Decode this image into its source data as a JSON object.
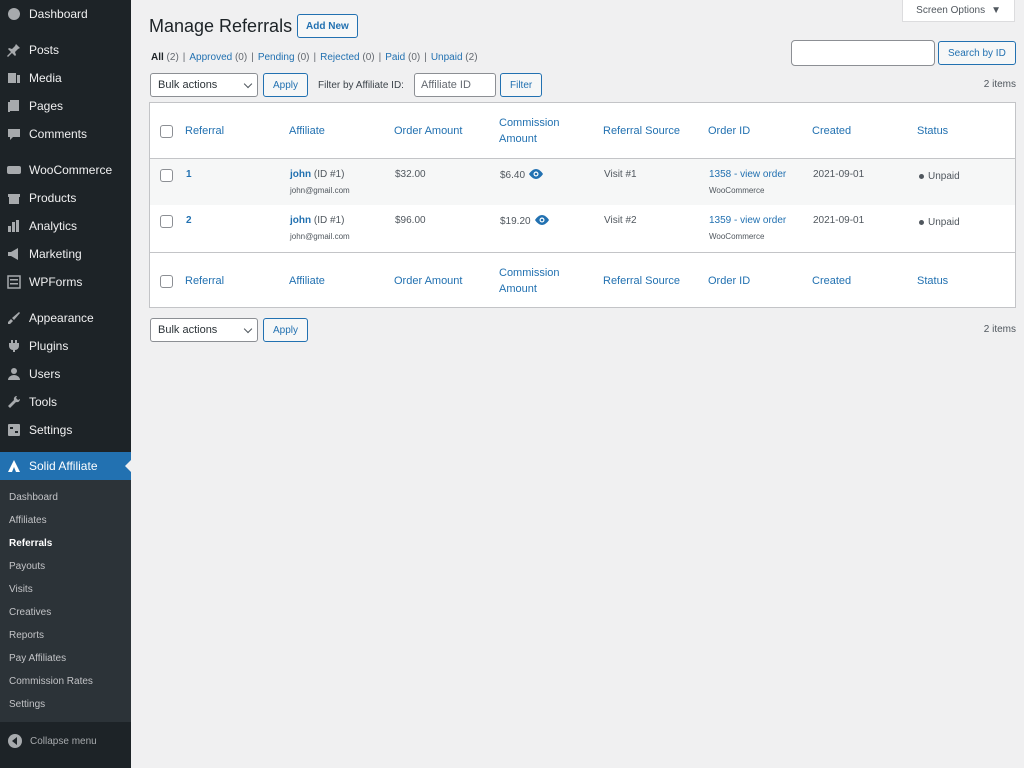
{
  "sidebar": {
    "groups": [
      [
        {
          "label": "Dashboard",
          "icon": "dashboard-icon"
        }
      ],
      [
        {
          "label": "Posts",
          "icon": "pin-icon"
        },
        {
          "label": "Media",
          "icon": "media-icon"
        },
        {
          "label": "Pages",
          "icon": "pages-icon"
        },
        {
          "label": "Comments",
          "icon": "comments-icon"
        }
      ],
      [
        {
          "label": "WooCommerce",
          "icon": "woocommerce-icon"
        },
        {
          "label": "Products",
          "icon": "products-icon"
        },
        {
          "label": "Analytics",
          "icon": "analytics-icon"
        },
        {
          "label": "Marketing",
          "icon": "megaphone-icon"
        },
        {
          "label": "WPForms",
          "icon": "wpforms-icon"
        }
      ],
      [
        {
          "label": "Appearance",
          "icon": "brush-icon"
        },
        {
          "label": "Plugins",
          "icon": "plugins-icon"
        },
        {
          "label": "Users",
          "icon": "users-icon"
        },
        {
          "label": "Tools",
          "icon": "wrench-icon"
        },
        {
          "label": "Settings",
          "icon": "settings-icon"
        }
      ]
    ],
    "active": {
      "label": "Solid Affiliate",
      "icon": "solid-affiliate-icon"
    },
    "submenu": [
      "Dashboard",
      "Affiliates",
      "Referrals",
      "Payouts",
      "Visits",
      "Creatives",
      "Reports",
      "Pay Affiliates",
      "Commission Rates",
      "Settings"
    ],
    "submenu_current": "Referrals",
    "collapse_label": "Collapse menu"
  },
  "header": {
    "screen_options": "Screen Options",
    "title": "Manage Referrals",
    "add_new": "Add New"
  },
  "views": [
    {
      "label": "All",
      "count": "(2)",
      "current": true
    },
    {
      "label": "Approved",
      "count": "(0)"
    },
    {
      "label": "Pending",
      "count": "(0)"
    },
    {
      "label": "Rejected",
      "count": "(0)"
    },
    {
      "label": "Paid",
      "count": "(0)"
    },
    {
      "label": "Unpaid",
      "count": "(2)"
    }
  ],
  "search": {
    "value": "",
    "button": "Search by ID"
  },
  "toolbar": {
    "bulk_actions": "Bulk actions",
    "apply": "Apply",
    "filter_label": "Filter by Affiliate ID:",
    "affiliate_placeholder": "Affiliate ID",
    "filter": "Filter",
    "items": "2 items"
  },
  "table": {
    "columns": [
      "Referral",
      "Affiliate",
      "Order Amount",
      "Commission Amount",
      "Referral Source",
      "Order ID",
      "Created",
      "Status"
    ],
    "rows": [
      {
        "referral": "1",
        "affiliate": "john",
        "affiliate_id": "(ID #1)",
        "email": "john@gmail.com",
        "order_amount": "$32.00",
        "commission": "$6.40",
        "source": "Visit #1",
        "order_id": "1358 - view order",
        "order_platform": "WooCommerce",
        "created": "2021-09-01",
        "status": "Unpaid"
      },
      {
        "referral": "2",
        "affiliate": "john",
        "affiliate_id": "(ID #1)",
        "email": "john@gmail.com",
        "order_amount": "$96.00",
        "commission": "$19.20",
        "source": "Visit #2",
        "order_id": "1359 - view order",
        "order_platform": "WooCommerce",
        "created": "2021-09-01",
        "status": "Unpaid"
      }
    ]
  },
  "colors": {
    "accent": "#2271b1",
    "sidebar": "#1d2327",
    "submenu": "#2c3338",
    "background": "#f0f0f1"
  }
}
